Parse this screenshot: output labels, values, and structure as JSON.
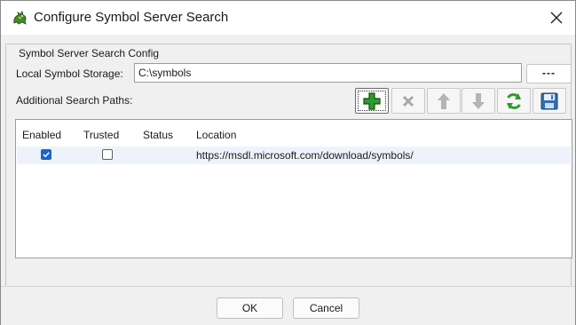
{
  "window": {
    "title": "Configure Symbol Server Search"
  },
  "group": {
    "label": "Symbol Server Search Config",
    "local_storage_label": "Local Symbol Storage:",
    "local_storage_value": "C:\\symbols",
    "browse_label": "---",
    "additional_paths_label": "Additional Search Paths:"
  },
  "toolbar": [
    {
      "name": "add-path-button",
      "icon": "green-plus-icon",
      "enabled": true
    },
    {
      "name": "remove-path-button",
      "icon": "red-x-icon",
      "enabled": false
    },
    {
      "name": "move-up-button",
      "icon": "arrow-up-icon",
      "enabled": false
    },
    {
      "name": "move-down-button",
      "icon": "arrow-down-icon",
      "enabled": false
    },
    {
      "name": "refresh-button",
      "icon": "refresh-icon",
      "enabled": true
    },
    {
      "name": "save-button",
      "icon": "floppy-disk-icon",
      "enabled": true
    }
  ],
  "table": {
    "columns": [
      "Enabled",
      "Trusted",
      "Status",
      "Location"
    ],
    "rows": [
      {
        "enabled": true,
        "trusted": false,
        "status": "",
        "location": "https://msdl.microsoft.com/download/symbols/"
      }
    ]
  },
  "buttons": {
    "ok": "OK",
    "cancel": "Cancel"
  },
  "colors": {
    "accent": "#1d63c7",
    "add_green": "#2e9b2e",
    "row_highlight": "#eef3fb"
  }
}
